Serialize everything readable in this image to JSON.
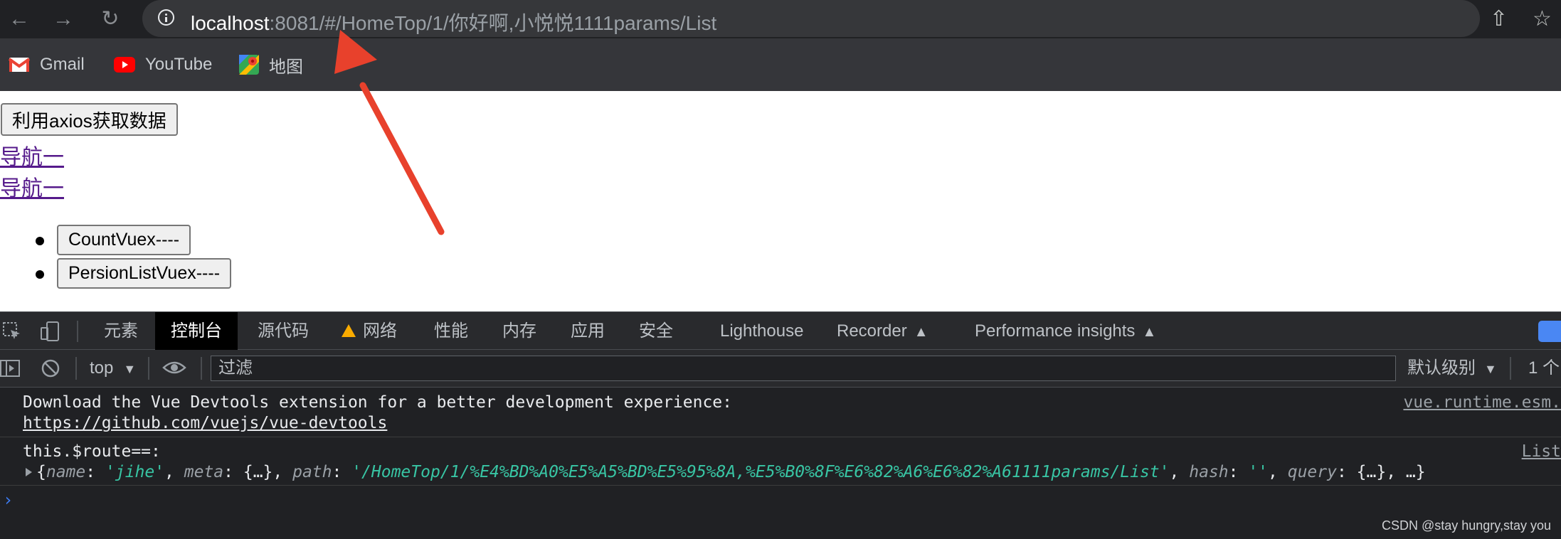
{
  "browser": {
    "url_host": "localhost",
    "url_rest": ":8081/#/HomeTop/1/你好啊,小悦悦1111params/List",
    "bookmarks": [
      {
        "label": "Gmail"
      },
      {
        "label": "YouTube"
      },
      {
        "label": "地图"
      }
    ]
  },
  "page": {
    "fetch_button": "利用axios获取数据",
    "nav_links": [
      "导航一",
      "导航一"
    ],
    "vuex_buttons": [
      "CountVuex----",
      "PersionListVuex----"
    ]
  },
  "devtools": {
    "tabs": [
      "元素",
      "控制台",
      "源代码",
      "网络",
      "性能",
      "内存",
      "应用",
      "安全",
      "Lighthouse",
      "Recorder",
      "Performance insights"
    ],
    "active_tab": "控制台",
    "context": "top",
    "filter_placeholder": "过滤",
    "levels": "默认级别",
    "issues": "1 个",
    "messages": {
      "m1_line1": "Download the Vue Devtools extension for a better development experience:",
      "m1_link": "https://github.com/vuejs/vue-devtools",
      "m1_source": "vue.runtime.esm.",
      "m2_line1": "this.$route==:",
      "m2_source": "List",
      "route": {
        "name_key": "name",
        "name_val": "'jihe'",
        "meta_key": "meta",
        "meta_val": "{…}",
        "path_key": "path",
        "path_val": "'/HomeTop/1/%E4%BD%A0%E5%A5%BD%E5%95%8A,%E5%B0%8F%E6%82%A6%E6%82%A61111params/List'",
        "hash_key": "hash",
        "hash_val": "''",
        "query_key": "query",
        "query_val": "{…}",
        "ellipsis": "…"
      }
    }
  },
  "watermark": "CSDN @stay hungry,stay you",
  "colors": {
    "annotation_arrow": "#e8412c",
    "link": "#551a8b",
    "string": "#5cd5fb"
  }
}
